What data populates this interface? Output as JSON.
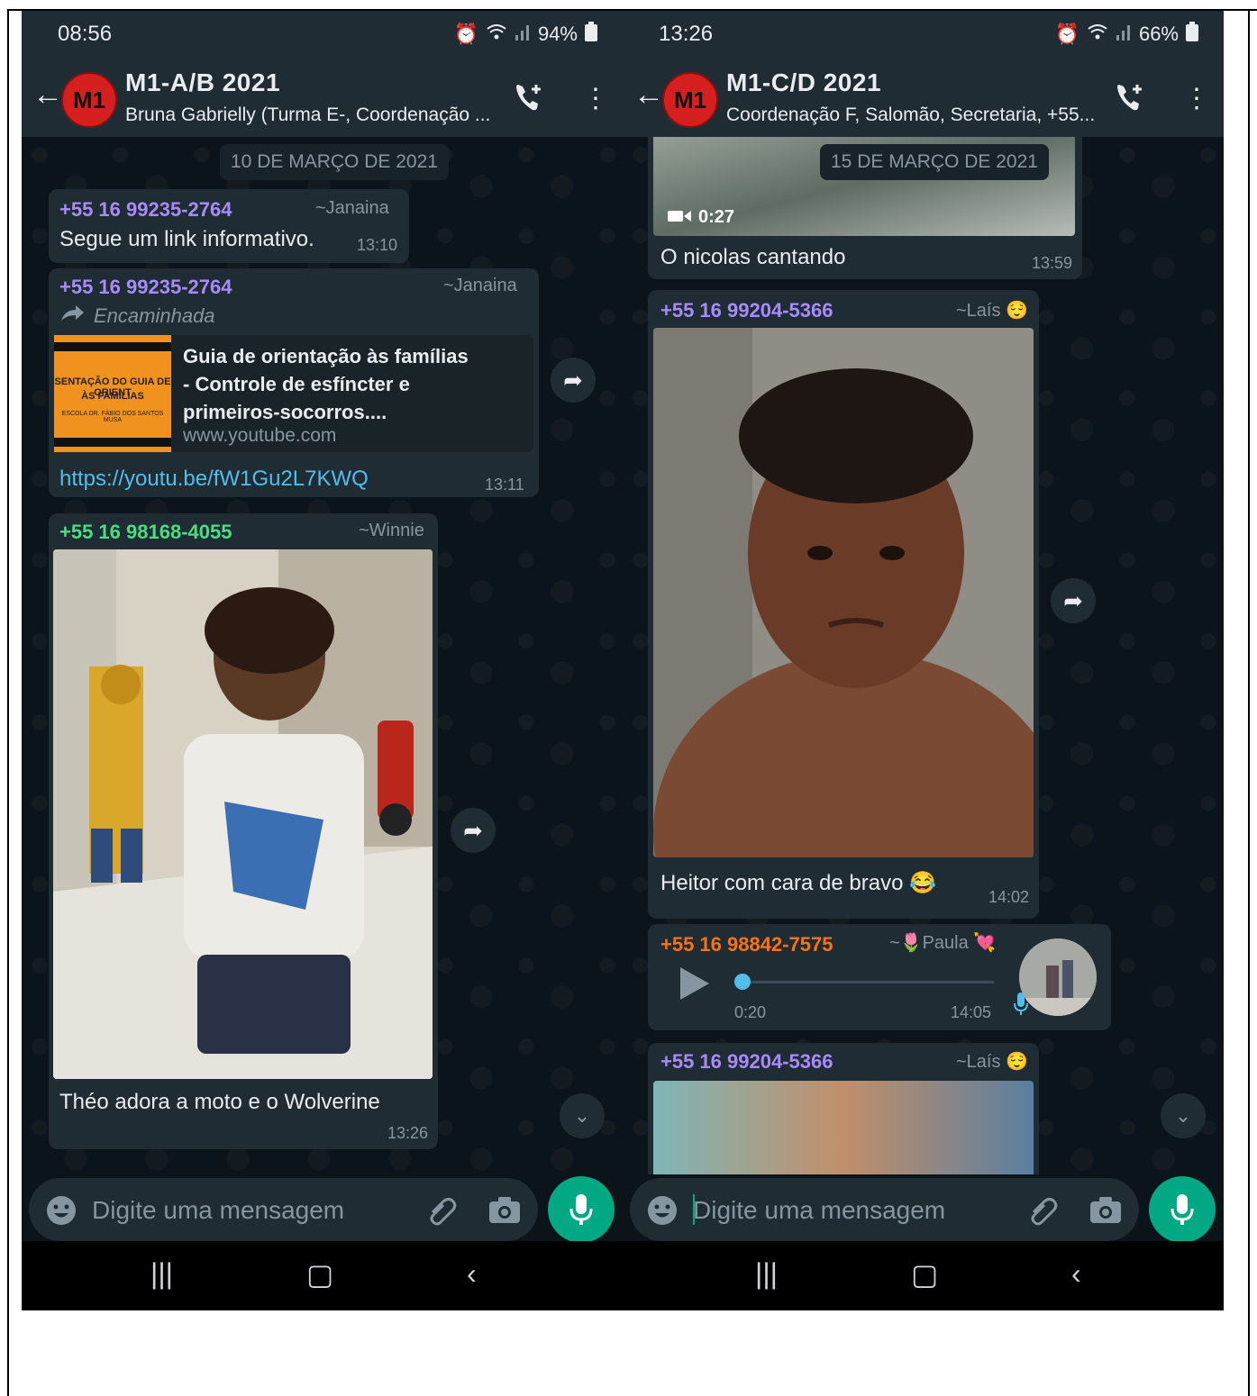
{
  "left": {
    "status": {
      "time": "08:56",
      "battery": "94%"
    },
    "header": {
      "title": "M1-A/B 2021",
      "subtitle": "Bruna Gabrielly (Turma E-, Coordenação ...",
      "avatar_text": "M1"
    },
    "date_chip": "10 DE MARÇO DE 2021",
    "messages": [
      {
        "sender": "+55 16 99235-2764",
        "nick": "~Janaina",
        "text": "Segue um link informativo.",
        "time": "13:10"
      },
      {
        "sender": "+55 16 99235-2764",
        "nick": "~Janaina",
        "forwarded": "Encaminhada",
        "thumb_line1": "SENTAÇÃO DO GUIA DE ORIENT",
        "thumb_line2": "ÀS FAMÍLIAS",
        "thumb_line3": "ESCOLA DR. FÁBIO DOS SANTOS MUSA",
        "preview_title": "Guia de orientação às famílias - Controle de esfíncter e primeiros-socorros....",
        "preview_url": "www.youtube.com",
        "link": "https://youtu.be/fW1Gu2L7KWQ",
        "time": "13:11"
      },
      {
        "sender": "+55 16 98168-4055",
        "nick": "~Winnie",
        "caption": "Théo adora a moto e o Wolverine",
        "time": "13:26"
      }
    ],
    "input_placeholder": "Digite uma mensagem"
  },
  "right": {
    "status": {
      "time": "13:26",
      "battery": "66%"
    },
    "header": {
      "title": "M1-C/D 2021",
      "subtitle": "Coordenação F, Salomão, Secretaria, +55...",
      "avatar_text": "M1"
    },
    "date_chip": "15 DE MARÇO DE 2021",
    "messages": [
      {
        "video_duration": "0:27",
        "caption": "O nicolas cantando",
        "time": "13:59"
      },
      {
        "sender": "+55 16 99204-5366",
        "nick": "~Laís 😌",
        "caption": "Heitor com cara de bravo 😂",
        "time": "14:02"
      },
      {
        "sender": "+55 16 98842-7575",
        "nick": "~🌷Paula 💘",
        "audio_duration": "0:20",
        "time": "14:05"
      },
      {
        "sender": "+55 16 99204-5366",
        "nick": "~Laís 😌"
      }
    ],
    "input_placeholder": "Digite uma mensagem"
  },
  "colors": {
    "bg": "#0b141a",
    "bar": "#1f2c34",
    "bubble": "#202c33",
    "accent": "#00a884",
    "link": "#53bdeb"
  },
  "icons": [
    "back-arrow-icon",
    "add-call-icon",
    "more-vert-icon",
    "forward-icon",
    "scroll-down-icon",
    "emoji-icon",
    "attach-icon",
    "camera-icon",
    "mic-icon",
    "video-icon",
    "play-icon",
    "recent-apps-icon",
    "home-icon",
    "nav-back-icon"
  ]
}
